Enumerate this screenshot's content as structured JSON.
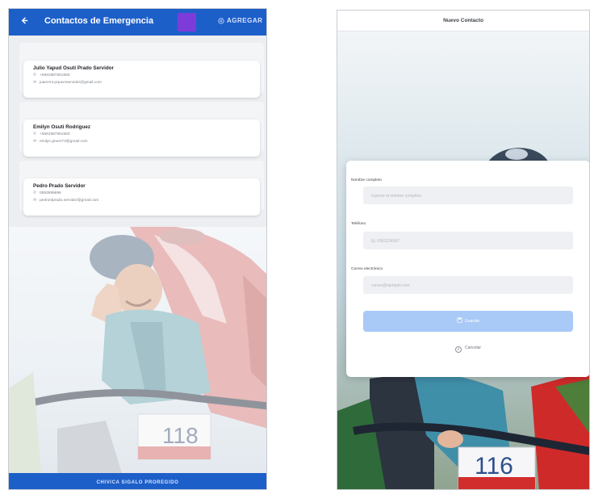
{
  "left_screen": {
    "appbar": {
      "back_icon": "arrow-left-icon",
      "title": "Contactos de Emergencia",
      "add_label": "AGREGAR",
      "add_icon": "plus-circle-icon",
      "color": "#1d5fc9",
      "tag_color": "#7d3cd9"
    },
    "contacts": [
      {
        "name": "Julio Yapud Osuti Prado Servidor",
        "phone": "+5591987651555",
        "email": "juanmnr.prpavoservidor@gmail.com"
      },
      {
        "name": "Emilyn Osuti Rodríguez",
        "phone": "+5591987651550",
        "email": "emilyn.gruen73@gmail.com"
      },
      {
        "name": "Pedro Prado Servidor",
        "phone": "0593999696",
        "email": "pedronlprado.servidor@gmail.com"
      }
    ],
    "phone_icon": "phone-icon",
    "email_icon": "envelope-icon",
    "bottom_bar_label": "CHIVICA SIGALO PROREGIDO",
    "photo_race_number": "118"
  },
  "right_screen": {
    "title": "Nuevo Contacto",
    "form": {
      "name_label": "Nombre completo",
      "name_placeholder": "Ingrese el nombre completo",
      "phone_label": "Teléfono",
      "phone_placeholder": "Ej: 0991234567",
      "email_label": "Correo electrónico",
      "email_placeholder": "correo@ejemplo.com",
      "save_label": "Guardar",
      "save_icon": "save-icon",
      "cancel_label": "Cancelar",
      "cancel_icon": "close-circle-icon"
    },
    "photo_race_number": "116"
  }
}
